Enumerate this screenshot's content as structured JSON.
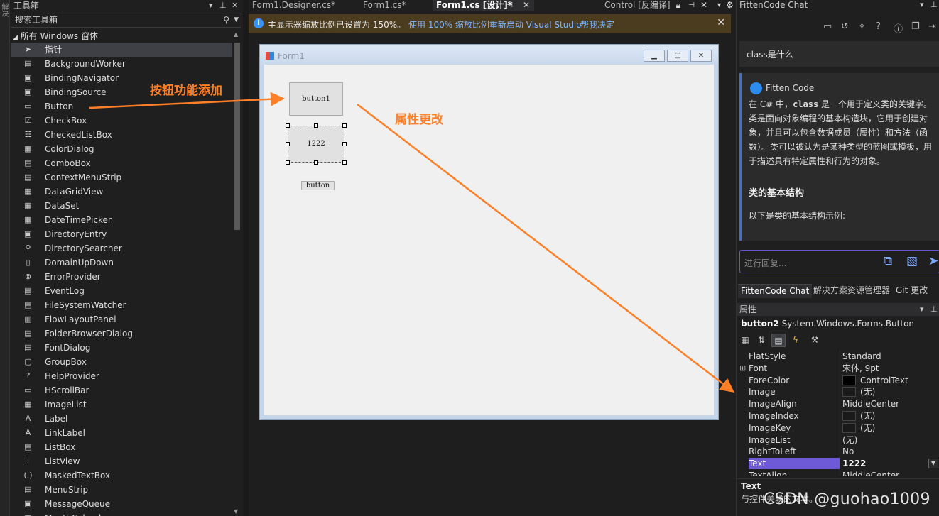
{
  "left_strip": {
    "label": "解决"
  },
  "toolbox": {
    "title": "工具箱",
    "search_placeholder": "搜索工具箱",
    "group": "所有 Windows 窗体",
    "items": [
      {
        "label": "指针",
        "icon": "pointer-icon",
        "glyph": "➤"
      },
      {
        "label": "BackgroundWorker",
        "icon": "backgroundworker-icon",
        "glyph": "▤"
      },
      {
        "label": "BindingNavigator",
        "icon": "bindingnavigator-icon",
        "glyph": "▣"
      },
      {
        "label": "BindingSource",
        "icon": "bindingsource-icon",
        "glyph": "▣"
      },
      {
        "label": "Button",
        "icon": "button-icon",
        "glyph": "▭"
      },
      {
        "label": "CheckBox",
        "icon": "checkbox-icon",
        "glyph": "☑"
      },
      {
        "label": "CheckedListBox",
        "icon": "checkedlistbox-icon",
        "glyph": "☷"
      },
      {
        "label": "ColorDialog",
        "icon": "colordialog-icon",
        "glyph": "▦"
      },
      {
        "label": "ComboBox",
        "icon": "combobox-icon",
        "glyph": "▤"
      },
      {
        "label": "ContextMenuStrip",
        "icon": "contextmenustrip-icon",
        "glyph": "▤"
      },
      {
        "label": "DataGridView",
        "icon": "datagridview-icon",
        "glyph": "▦"
      },
      {
        "label": "DataSet",
        "icon": "dataset-icon",
        "glyph": "▦"
      },
      {
        "label": "DateTimePicker",
        "icon": "datetimepicker-icon",
        "glyph": "▦"
      },
      {
        "label": "DirectoryEntry",
        "icon": "directoryentry-icon",
        "glyph": "▣"
      },
      {
        "label": "DirectorySearcher",
        "icon": "directorysearcher-icon",
        "glyph": "⚲"
      },
      {
        "label": "DomainUpDown",
        "icon": "domainupdown-icon",
        "glyph": "▯"
      },
      {
        "label": "ErrorProvider",
        "icon": "errorprovider-icon",
        "glyph": "⊗"
      },
      {
        "label": "EventLog",
        "icon": "eventlog-icon",
        "glyph": "▤"
      },
      {
        "label": "FileSystemWatcher",
        "icon": "filesystemwatcher-icon",
        "glyph": "▤"
      },
      {
        "label": "FlowLayoutPanel",
        "icon": "flowlayoutpanel-icon",
        "glyph": "▥"
      },
      {
        "label": "FolderBrowserDialog",
        "icon": "folderbrowserdialog-icon",
        "glyph": "▤"
      },
      {
        "label": "FontDialog",
        "icon": "fontdialog-icon",
        "glyph": "▤"
      },
      {
        "label": "GroupBox",
        "icon": "groupbox-icon",
        "glyph": "▢"
      },
      {
        "label": "HelpProvider",
        "icon": "helpprovider-icon",
        "glyph": "?"
      },
      {
        "label": "HScrollBar",
        "icon": "hscrollbar-icon",
        "glyph": "▭"
      },
      {
        "label": "ImageList",
        "icon": "imagelist-icon",
        "glyph": "▦"
      },
      {
        "label": "Label",
        "icon": "label-icon",
        "glyph": "A"
      },
      {
        "label": "LinkLabel",
        "icon": "linklabel-icon",
        "glyph": "A"
      },
      {
        "label": "ListBox",
        "icon": "listbox-icon",
        "glyph": "▤"
      },
      {
        "label": "ListView",
        "icon": "listview-icon",
        "glyph": "⁝"
      },
      {
        "label": "MaskedTextBox",
        "icon": "maskedtextbox-icon",
        "glyph": "(.)"
      },
      {
        "label": "MenuStrip",
        "icon": "menustrip-icon",
        "glyph": "▤"
      },
      {
        "label": "MessageQueue",
        "icon": "messagequeue-icon",
        "glyph": "▣"
      },
      {
        "label": "MonthCalendar",
        "icon": "monthcalendar-icon",
        "glyph": "▦"
      }
    ]
  },
  "tabs": [
    {
      "label": "Form1.Designer.cs*"
    },
    {
      "label": "Form1.cs*"
    },
    {
      "label": "Form1.cs [设计]*"
    },
    {
      "label": "Control [反编译]"
    }
  ],
  "infobar": {
    "message": "主显示器缩放比例已设置为 150%。",
    "link_restart": "使用 100% 缩放比例重新启动 Visual Studio",
    "link_decide": "帮我决定"
  },
  "form": {
    "title": "Form1",
    "button1": "button1",
    "button2": "1222",
    "button3": "button"
  },
  "annotations": {
    "add": "按钮功能添加",
    "change": "属性更改"
  },
  "fitten": {
    "title": "FittenCode Chat",
    "question": "class是什么",
    "bot_name": "Fitten Code",
    "answer_code_word": "class",
    "answer_pre": "在 C# 中，",
    "answer_post": " 是一个用于定义类的关键字。类是面向对象编程的基本构造块，它用于创建对象，并且可以包含数据成员（属性）和方法（函数）。类可以被认为是某种类型的蓝图或模板，用于描述具有特定属性和行为的对象。",
    "heading": "类的基本结构",
    "para2": "以下是类的基本结构示例:",
    "input_placeholder": "进行回复...",
    "tabs": [
      "FittenCode Chat",
      "解决方案资源管理器",
      "Git 更改"
    ]
  },
  "properties": {
    "title": "属性",
    "object_name": "button2",
    "object_type": "System.Windows.Forms.Button",
    "rows": [
      {
        "name": "FlatStyle",
        "value": "Standard"
      },
      {
        "name": "Font",
        "value": "宋体, 9pt",
        "expandable": true
      },
      {
        "name": "ForeColor",
        "value": "ControlText",
        "swatch": "#000000"
      },
      {
        "name": "Image",
        "value": "(无)",
        "swatch": "#1a1a1a"
      },
      {
        "name": "ImageAlign",
        "value": "MiddleCenter"
      },
      {
        "name": "ImageIndex",
        "value": "(无)",
        "swatch": "#1a1a1a"
      },
      {
        "name": "ImageKey",
        "value": "(无)",
        "swatch": "#1a1a1a"
      },
      {
        "name": "ImageList",
        "value": "(无)"
      },
      {
        "name": "RightToLeft",
        "value": "No"
      },
      {
        "name": "Text",
        "value": "1222",
        "selected": true
      },
      {
        "name": "TextAlign",
        "value": "MiddleCenter"
      }
    ],
    "desc_title": "Text",
    "desc_text": "与控件关联的文本。"
  },
  "watermark": "CSDN @guohao1009",
  "colors": {
    "accent": "#ff7f27",
    "selection": "#6e5ad6",
    "infobar": "#4b3b1f"
  }
}
